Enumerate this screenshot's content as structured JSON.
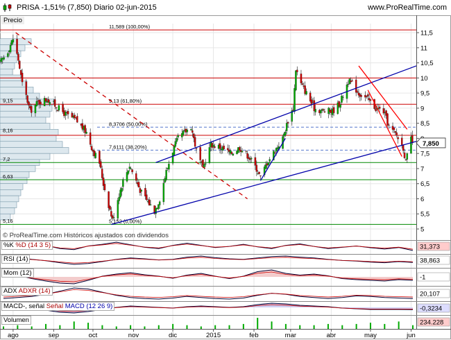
{
  "header": {
    "title": "PRISA  -1,51% (7,850)  Diario  02-jun-2015",
    "site": "www.ProRealTime.com"
  },
  "main_panel": {
    "label": "Precio",
    "watermark": "© ProRealTime.com  Históricos ajustados con dividendos"
  },
  "chart_data": {
    "type": "candlestick",
    "title": "PRISA  -1,51% (7,850)  Diario  02-jun-2015",
    "last_price": 7.85,
    "last_price_label": "7,850",
    "ylim": [
      5,
      11.8
    ],
    "y_ticks": [
      5,
      5.5,
      6,
      6.5,
      7,
      7.5,
      8,
      8.5,
      9,
      9.5,
      10,
      10.5,
      11,
      11.5
    ],
    "y_tick_labels": [
      "5",
      "5,5",
      "6",
      "6,5",
      "7",
      "7,5",
      "8",
      "8,5",
      "9",
      "9,5",
      "10",
      "10,5",
      "11",
      "11,5"
    ],
    "x_range": [
      "2014-07-22",
      "2015-06-05"
    ],
    "x_ticks": [
      {
        "date": "2014-08-01",
        "label": "ago"
      },
      {
        "date": "2014-09-01",
        "label": "sep"
      },
      {
        "date": "2014-10-01",
        "label": "oct"
      },
      {
        "date": "2014-11-01",
        "label": "nov"
      },
      {
        "date": "2014-12-01",
        "label": "dic"
      },
      {
        "date": "2015-01-01",
        "label": "2015"
      },
      {
        "date": "2015-02-01",
        "label": "feb"
      },
      {
        "date": "2015-03-01",
        "label": "mar"
      },
      {
        "date": "2015-04-01",
        "label": "abr"
      },
      {
        "date": "2015-05-01",
        "label": "may"
      },
      {
        "date": "2015-06-01",
        "label": "jun"
      }
    ],
    "close_anchors": [
      {
        "date": "2014-07-22",
        "close": 10.5
      },
      {
        "date": "2014-07-28",
        "close": 10.9
      },
      {
        "date": "2014-08-01",
        "close": 11.3
      },
      {
        "date": "2014-08-05",
        "close": 10.6
      },
      {
        "date": "2014-08-08",
        "close": 9.8
      },
      {
        "date": "2014-08-11",
        "close": 9.4
      },
      {
        "date": "2014-08-14",
        "close": 8.9
      },
      {
        "date": "2014-08-20",
        "close": 9.2
      },
      {
        "date": "2014-08-27",
        "close": 9.3
      },
      {
        "date": "2014-09-02",
        "close": 9.1
      },
      {
        "date": "2014-09-10",
        "close": 8.8
      },
      {
        "date": "2014-09-18",
        "close": 8.6
      },
      {
        "date": "2014-09-26",
        "close": 8.2
      },
      {
        "date": "2014-10-01",
        "close": 7.6
      },
      {
        "date": "2014-10-06",
        "close": 7.2
      },
      {
        "date": "2014-10-09",
        "close": 6.5
      },
      {
        "date": "2014-10-13",
        "close": 5.8
      },
      {
        "date": "2014-10-16",
        "close": 5.3
      },
      {
        "date": "2014-10-20",
        "close": 6.0
      },
      {
        "date": "2014-10-24",
        "close": 6.6
      },
      {
        "date": "2014-10-29",
        "close": 7.1
      },
      {
        "date": "2014-11-03",
        "close": 6.6
      },
      {
        "date": "2014-11-07",
        "close": 6.2
      },
      {
        "date": "2014-11-12",
        "close": 5.9
      },
      {
        "date": "2014-11-17",
        "close": 5.6
      },
      {
        "date": "2014-11-21",
        "close": 6.0
      },
      {
        "date": "2014-11-26",
        "close": 6.9
      },
      {
        "date": "2014-12-01",
        "close": 7.6
      },
      {
        "date": "2014-12-05",
        "close": 8.0
      },
      {
        "date": "2014-12-10",
        "close": 8.2
      },
      {
        "date": "2014-12-15",
        "close": 8.4
      },
      {
        "date": "2014-12-19",
        "close": 7.6
      },
      {
        "date": "2014-12-24",
        "close": 7.0
      },
      {
        "date": "2014-12-30",
        "close": 7.8
      },
      {
        "date": "2015-01-07",
        "close": 7.7
      },
      {
        "date": "2015-01-14",
        "close": 7.5
      },
      {
        "date": "2015-01-21",
        "close": 7.7
      },
      {
        "date": "2015-01-28",
        "close": 7.4
      },
      {
        "date": "2015-02-03",
        "close": 7.0
      },
      {
        "date": "2015-02-06",
        "close": 6.7
      },
      {
        "date": "2015-02-11",
        "close": 7.2
      },
      {
        "date": "2015-02-17",
        "close": 7.6
      },
      {
        "date": "2015-02-23",
        "close": 8.0
      },
      {
        "date": "2015-02-27",
        "close": 8.6
      },
      {
        "date": "2015-03-03",
        "close": 9.0
      },
      {
        "date": "2015-03-05",
        "close": 10.3
      },
      {
        "date": "2015-03-09",
        "close": 9.8
      },
      {
        "date": "2015-03-13",
        "close": 9.5
      },
      {
        "date": "2015-03-19",
        "close": 9.0
      },
      {
        "date": "2015-03-26",
        "close": 8.9
      },
      {
        "date": "2015-04-02",
        "close": 8.9
      },
      {
        "date": "2015-04-08",
        "close": 9.2
      },
      {
        "date": "2015-04-14",
        "close": 9.9
      },
      {
        "date": "2015-04-17",
        "close": 9.8
      },
      {
        "date": "2015-04-22",
        "close": 9.5
      },
      {
        "date": "2015-04-29",
        "close": 9.3
      },
      {
        "date": "2015-05-05",
        "close": 9.0
      },
      {
        "date": "2015-05-11",
        "close": 8.9
      },
      {
        "date": "2015-05-15",
        "close": 8.4
      },
      {
        "date": "2015-05-21",
        "close": 8.1
      },
      {
        "date": "2015-05-26",
        "close": 7.7
      },
      {
        "date": "2015-05-28",
        "close": 7.2
      },
      {
        "date": "2015-06-01",
        "close": 8.0
      },
      {
        "date": "2015-06-02",
        "close": 7.85
      }
    ],
    "fibonacci_levels": [
      {
        "value": 11.589,
        "label": "11,589 (100,00%)"
      },
      {
        "value": 9.13,
        "label": "9,13 (61,80%)"
      },
      {
        "value": 8.3706,
        "label": "8,3706 (50,00%)"
      },
      {
        "value": 7.6111,
        "label": "7,6111 (38,20%)"
      },
      {
        "value": 5.152,
        "label": "5,152 (0,00%)"
      }
    ],
    "horizontal_levels": [
      {
        "value": 11.589,
        "color": "#cc0000"
      },
      {
        "value": 10.0,
        "color": "#cc0000"
      },
      {
        "value": 9.13,
        "color": "#cc0000"
      },
      {
        "value": 8.1,
        "color": "#cc0000"
      },
      {
        "value": 7.2,
        "color": "#008800"
      },
      {
        "value": 6.63,
        "color": "#008800"
      },
      {
        "value": 5.152,
        "color": "#008800"
      }
    ],
    "dashed_levels": [
      8.3706,
      7.6111
    ],
    "volume_profile": [
      {
        "price": 11.2,
        "volume": 0.15
      },
      {
        "price": 11.0,
        "volume": 0.12
      },
      {
        "price": 10.8,
        "volume": 0.1
      },
      {
        "price": 10.6,
        "volume": 0.08
      },
      {
        "price": 10.4,
        "volume": 0.07
      },
      {
        "price": 10.2,
        "volume": 0.06
      },
      {
        "price": 10.0,
        "volume": 0.1
      },
      {
        "price": 9.8,
        "volume": 0.13
      },
      {
        "price": 9.6,
        "volume": 0.16
      },
      {
        "price": 9.4,
        "volume": 0.19
      },
      {
        "price": 9.2,
        "volume": 0.26
      },
      {
        "price": 9.0,
        "volume": 0.25
      },
      {
        "price": 8.8,
        "volume": 0.24
      },
      {
        "price": 8.6,
        "volume": 0.22
      },
      {
        "price": 8.4,
        "volume": 0.24
      },
      {
        "price": 8.2,
        "volume": 0.28
      },
      {
        "price": 8.0,
        "volume": 0.27
      },
      {
        "price": 7.8,
        "volume": 0.3
      },
      {
        "price": 7.6,
        "volume": 0.33
      },
      {
        "price": 7.4,
        "volume": 0.24
      },
      {
        "price": 7.2,
        "volume": 0.19
      },
      {
        "price": 7.0,
        "volume": 0.17
      },
      {
        "price": 6.8,
        "volume": 0.14
      },
      {
        "price": 6.6,
        "volume": 0.13
      },
      {
        "price": 6.4,
        "volume": 0.11
      },
      {
        "price": 6.2,
        "volume": 0.1
      },
      {
        "price": 6.0,
        "volume": 0.09
      },
      {
        "price": 5.8,
        "volume": 0.08
      },
      {
        "price": 5.6,
        "volume": 0.07
      },
      {
        "price": 5.4,
        "volume": 0.05
      }
    ],
    "volume_profile_labels": [
      {
        "price": 9.15,
        "label": "9,15"
      },
      {
        "price": 8.16,
        "label": "8,16"
      },
      {
        "price": 7.2,
        "label": "7,2"
      },
      {
        "price": 6.63,
        "label": "6,63"
      },
      {
        "price": 5.16,
        "label": "5,16"
      }
    ],
    "trendlines": [
      {
        "color": "#0000aa",
        "from": {
          "date": "2014-10-15",
          "value": 5.15
        },
        "to": {
          "date": "2015-06-05",
          "value": 7.9
        }
      },
      {
        "color": "#0000aa",
        "from": {
          "date": "2014-11-18",
          "value": 7.2
        },
        "to": {
          "date": "2015-06-05",
          "value": 10.4
        }
      },
      {
        "color": "#0000aa",
        "from": {
          "date": "2015-02-06",
          "value": 6.6
        },
        "to": {
          "date": "2015-02-25",
          "value": 8.0
        }
      },
      {
        "color": "#ff0000",
        "from": {
          "date": "2015-04-22",
          "value": 10.4
        },
        "to": {
          "date": "2015-05-29",
          "value": 8.3
        }
      },
      {
        "color": "#ff0000",
        "from": {
          "date": "2015-04-29",
          "value": 9.6
        },
        "to": {
          "date": "2015-05-25",
          "value": 7.4
        }
      },
      {
        "color": "#cc0000",
        "dashed": true,
        "from": {
          "date": "2014-08-03",
          "value": 11.5
        },
        "to": {
          "date": "2015-01-27",
          "value": 6.0
        }
      }
    ]
  },
  "indicators": [
    {
      "id": "stoch",
      "label": "%K",
      "label2": "%D (14 3 5)",
      "value_label": "31,373",
      "box_color": "#ffcccc",
      "text_color": "#000000",
      "curve": [
        50,
        62,
        45,
        55,
        40,
        35,
        52,
        60,
        70,
        58,
        46,
        40,
        55,
        65,
        55,
        45,
        50,
        60,
        48,
        40,
        55,
        62,
        50,
        40,
        46,
        52,
        44,
        38,
        45,
        31
      ]
    },
    {
      "id": "rsi",
      "label": "RSI (14)",
      "value_label": "38,863",
      "box_color": "#ffffff",
      "text_color": "#000000",
      "curve": [
        55,
        58,
        50,
        45,
        38,
        32,
        35,
        42,
        50,
        55,
        52,
        48,
        50,
        58,
        62,
        56,
        52,
        50,
        55,
        60,
        62,
        58,
        55,
        50,
        46,
        44,
        40,
        38,
        42,
        39
      ]
    },
    {
      "id": "mom",
      "label": "Mom (12)",
      "value_label": "-1",
      "box_color": "#ffffff",
      "text_color": "#000000",
      "curve": [
        1.0,
        0.5,
        -0.5,
        -1.2,
        -1.8,
        -2.0,
        -1.0,
        0.2,
        0.8,
        1.2,
        0.6,
        0.2,
        -0.4,
        0.5,
        1.0,
        0.2,
        -0.5,
        0.2,
        1.5,
        2.0,
        1.0,
        0.5,
        0.8,
        0.3,
        -0.5,
        -0.8,
        -1.0,
        -1.2,
        -0.8,
        -1.0
      ]
    },
    {
      "id": "adx",
      "label": "ADX",
      "label2": "ADXR (14)",
      "value_label": "20,107",
      "box_color": "#ffffff",
      "text_color": "#000000",
      "curve": [
        20,
        22,
        24,
        28,
        34,
        40,
        38,
        32,
        26,
        22,
        20,
        19,
        21,
        24,
        22,
        20,
        19,
        21,
        26,
        30,
        28,
        24,
        22,
        20,
        22,
        25,
        24,
        22,
        21,
        20
      ]
    },
    {
      "id": "macd",
      "label": "MACD-, señal",
      "label2": "Señal",
      "label3": "MACD (12 26 9)",
      "value_label": "-0,3234",
      "box_color": "#ddddff",
      "text_color": "#000000",
      "curve": [
        0.4,
        0.2,
        -0.1,
        -0.4,
        -0.7,
        -0.8,
        -0.6,
        -0.3,
        0.0,
        0.2,
        0.1,
        0.0,
        -0.1,
        0.1,
        0.2,
        0.1,
        0.0,
        0.1,
        0.4,
        0.6,
        0.5,
        0.3,
        0.2,
        0.1,
        -0.1,
        -0.2,
        -0.3,
        -0.3,
        -0.3,
        -0.32
      ]
    },
    {
      "id": "vol",
      "label": "Volumen",
      "value_label": "234.228",
      "box_color": "#ffcccc",
      "text_color": "#000000",
      "curve": [
        0.2,
        0.3,
        0.2,
        0.4,
        0.3,
        0.6,
        0.5,
        0.3,
        0.2,
        0.3,
        0.2,
        0.3,
        0.4,
        0.3,
        0.2,
        0.3,
        0.3,
        0.4,
        0.9,
        0.6,
        0.4,
        0.3,
        0.3,
        0.4,
        0.3,
        0.4,
        0.5,
        0.4,
        0.6,
        0.3
      ]
    }
  ],
  "colors": {
    "up": "#00aa00",
    "down": "#cc0000",
    "profile_fill": "#dde8ee",
    "profile_stroke": "#7a9aaa",
    "grid": "#e6e6e6"
  }
}
